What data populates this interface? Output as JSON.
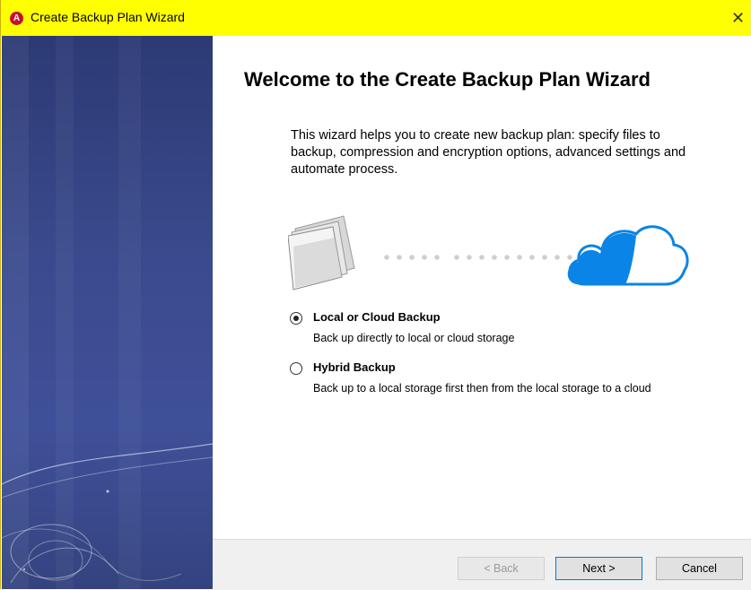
{
  "window": {
    "title": "Create Backup Plan Wizard",
    "close_glyph": "✕",
    "app_icon_glyph": "A"
  },
  "heading": "Welcome to the Create Backup Plan Wizard",
  "intro": "This wizard helps you to create new backup plan: specify files to backup, compression and encryption options, advanced settings and automate process.",
  "options": [
    {
      "label": "Local or Cloud Backup",
      "description": "Back up directly to local or cloud storage",
      "selected": true
    },
    {
      "label": "Hybrid Backup",
      "description": "Back up to a local storage first then from the local storage to a cloud",
      "selected": false
    }
  ],
  "buttons": {
    "back": "< Back",
    "next": "Next >",
    "cancel": "Cancel"
  },
  "colors": {
    "titlebar": "#ffff00",
    "side_panel": "#3a4a8d",
    "cloud": "#0a84e6",
    "default_button_border": "#0078d7"
  }
}
